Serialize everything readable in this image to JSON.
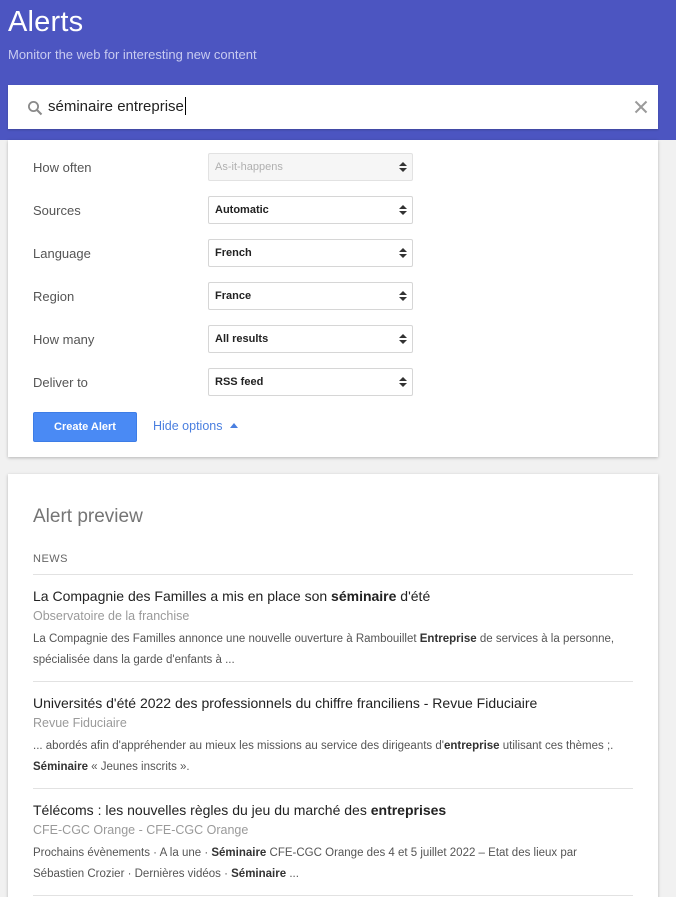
{
  "header": {
    "title": "Alerts",
    "subtitle": "Monitor the web for interesting new content",
    "color": "#4c55c1"
  },
  "search": {
    "value": "séminaire entreprise",
    "icons": {
      "left": "search-icon",
      "right": "close-icon"
    }
  },
  "options": {
    "how_often": {
      "label": "How often",
      "value": "As-it-happens",
      "disabled": true
    },
    "sources": {
      "label": "Sources",
      "value": "Automatic"
    },
    "language": {
      "label": "Language",
      "value": "French"
    },
    "region": {
      "label": "Region",
      "value": "France"
    },
    "how_many": {
      "label": "How many",
      "value": "All results"
    },
    "deliver_to": {
      "label": "Deliver to",
      "value": "RSS feed"
    },
    "create_label": "Create Alert",
    "hide_options_label": "Hide options",
    "accent": "#4a8af4"
  },
  "preview": {
    "title": "Alert preview",
    "section": "NEWS",
    "results": [
      {
        "title_parts": [
          {
            "text": "La Compagnie des Familles a mis en place son ",
            "bold": false
          },
          {
            "text": "séminaire",
            "bold": true
          },
          {
            "text": " d'été",
            "bold": false
          }
        ],
        "source": "Observatoire de la franchise",
        "snippet_lines": [
          [
            {
              "text": "La Compagnie des Familles annonce une nouvelle ouverture à Rambouillet ",
              "bold": false
            },
            {
              "text": "Entreprise",
              "bold": true
            },
            {
              "text": " de services à la personne,",
              "bold": false
            }
          ],
          [
            {
              "text": "spécialisée dans la garde d'enfants à ...",
              "bold": false
            }
          ]
        ]
      },
      {
        "title_parts": [
          {
            "text": "Universités d'été 2022 des professionnels du chiffre franciliens - Revue Fiduciaire",
            "bold": false
          }
        ],
        "source": "Revue Fiduciaire",
        "snippet_lines": [
          [
            {
              "text": "... abordés afin d'appréhender au mieux les missions au service des dirigeants d'",
              "bold": false
            },
            {
              "text": "entreprise",
              "bold": true
            },
            {
              "text": " utilisant ces thèmes ;.",
              "bold": false
            }
          ],
          [
            {
              "text": "Séminaire",
              "bold": true
            },
            {
              "text": " « Jeunes inscrits ».",
              "bold": false
            }
          ]
        ]
      },
      {
        "title_parts": [
          {
            "text": "Télécoms : les nouvelles règles du jeu du marché des ",
            "bold": false
          },
          {
            "text": "entreprises",
            "bold": true
          }
        ],
        "source": "CFE-CGC Orange - CFE-CGC Orange",
        "snippet_lines": [
          [
            {
              "text": "Prochains évènements · A la une · ",
              "bold": false
            },
            {
              "text": "Séminaire",
              "bold": true
            },
            {
              "text": " CFE-CGC Orange des 4 et 5 juillet 2022 – Etat des lieux par",
              "bold": false
            }
          ],
          [
            {
              "text": "Sébastien Crozier · Dernières vidéos · ",
              "bold": false
            },
            {
              "text": "Séminaire",
              "bold": true
            },
            {
              "text": " ...",
              "bold": false
            }
          ]
        ]
      }
    ]
  }
}
